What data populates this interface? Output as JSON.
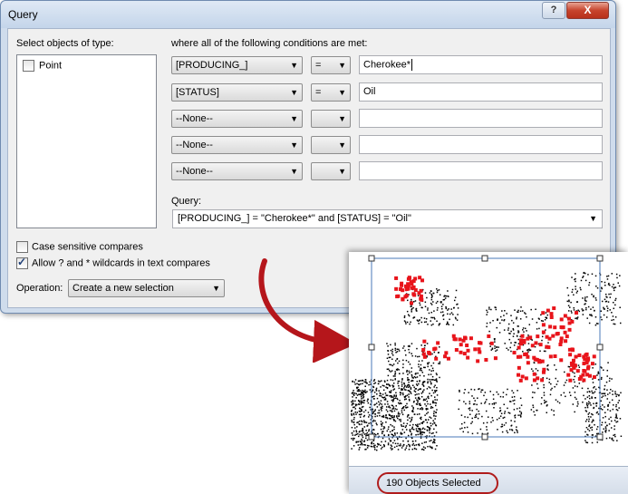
{
  "dialog": {
    "title": "Query",
    "help_label": "?",
    "close_label": "X"
  },
  "object_types": {
    "label": "Select objects of type:",
    "items": [
      {
        "label": "Point",
        "checked": false
      }
    ]
  },
  "conditions": {
    "label": "where all of the following conditions are met:",
    "rows": [
      {
        "field": "[PRODUCING_]",
        "operator": "=",
        "value": "Cherokee*"
      },
      {
        "field": "[STATUS]",
        "operator": "=",
        "value": "Oil"
      },
      {
        "field": "--None--",
        "operator": "",
        "value": ""
      },
      {
        "field": "--None--",
        "operator": "",
        "value": ""
      },
      {
        "field": "--None--",
        "operator": "",
        "value": ""
      }
    ]
  },
  "query": {
    "label": "Query:",
    "value": "[PRODUCING_] = \"Cherokee*\" and [STATUS] = \"Oil\""
  },
  "options": {
    "case_sensitive": {
      "label": "Case sensitive compares",
      "checked": false
    },
    "wildcards": {
      "label": "Allow ? and * wildcards in text compares",
      "checked": true
    }
  },
  "operation": {
    "label": "Operation:",
    "value": "Create a new selection"
  },
  "map": {
    "status_text": "190 Objects Selected",
    "selected_color": "#e8141b",
    "point_color": "#000000",
    "selection_frame_color": "#4a79b8"
  }
}
